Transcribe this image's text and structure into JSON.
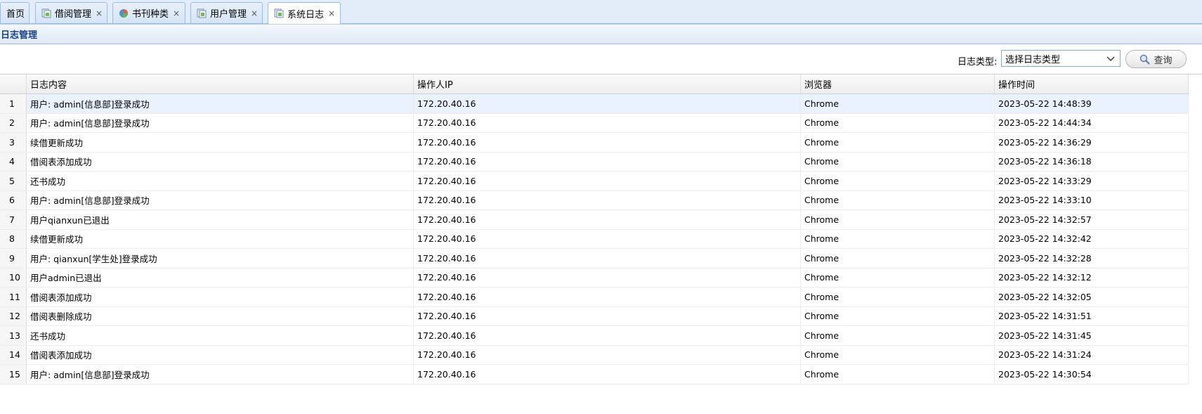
{
  "tabs": [
    {
      "label": "首页",
      "icon": "",
      "closable": false,
      "active": false
    },
    {
      "label": "借阅管理",
      "icon": "page-icon",
      "closable": true,
      "active": false
    },
    {
      "label": "书刊种类",
      "icon": "pie-chart-icon",
      "closable": true,
      "active": false
    },
    {
      "label": "用户管理",
      "icon": "page-icon",
      "closable": true,
      "active": false
    },
    {
      "label": "系统日志",
      "icon": "page-icon",
      "closable": true,
      "active": true
    }
  ],
  "tab_close_glyph": "×",
  "panel": {
    "title": "日志管理"
  },
  "toolbar": {
    "filter_label": "日志类型:",
    "filter_value": "选择日志类型",
    "query_label": "查询"
  },
  "grid": {
    "columns": [
      "",
      "日志内容",
      "操作人IP",
      "浏览器",
      "操作时间"
    ],
    "rows": [
      {
        "no": "1",
        "content": "用户: admin[信息部]登录成功",
        "ip": "172.20.40.16",
        "browser": "Chrome",
        "time": "2023-05-22 14:48:39"
      },
      {
        "no": "2",
        "content": "用户: admin[信息部]登录成功",
        "ip": "172.20.40.16",
        "browser": "Chrome",
        "time": "2023-05-22 14:44:34"
      },
      {
        "no": "3",
        "content": "续借更新成功",
        "ip": "172.20.40.16",
        "browser": "Chrome",
        "time": "2023-05-22 14:36:29"
      },
      {
        "no": "4",
        "content": "借阅表添加成功",
        "ip": "172.20.40.16",
        "browser": "Chrome",
        "time": "2023-05-22 14:36:18"
      },
      {
        "no": "5",
        "content": "还书成功",
        "ip": "172.20.40.16",
        "browser": "Chrome",
        "time": "2023-05-22 14:33:29"
      },
      {
        "no": "6",
        "content": "用户: admin[信息部]登录成功",
        "ip": "172.20.40.16",
        "browser": "Chrome",
        "time": "2023-05-22 14:33:10"
      },
      {
        "no": "7",
        "content": "用户qianxun已退出",
        "ip": "172.20.40.16",
        "browser": "Chrome",
        "time": "2023-05-22 14:32:57"
      },
      {
        "no": "8",
        "content": "续借更新成功",
        "ip": "172.20.40.16",
        "browser": "Chrome",
        "time": "2023-05-22 14:32:42"
      },
      {
        "no": "9",
        "content": "用户: qianxun[学生处]登录成功",
        "ip": "172.20.40.16",
        "browser": "Chrome",
        "time": "2023-05-22 14:32:28"
      },
      {
        "no": "10",
        "content": "用户admin已退出",
        "ip": "172.20.40.16",
        "browser": "Chrome",
        "time": "2023-05-22 14:32:12"
      },
      {
        "no": "11",
        "content": "借阅表添加成功",
        "ip": "172.20.40.16",
        "browser": "Chrome",
        "time": "2023-05-22 14:32:05"
      },
      {
        "no": "12",
        "content": "借阅表删除成功",
        "ip": "172.20.40.16",
        "browser": "Chrome",
        "time": "2023-05-22 14:31:51"
      },
      {
        "no": "13",
        "content": "还书成功",
        "ip": "172.20.40.16",
        "browser": "Chrome",
        "time": "2023-05-22 14:31:45"
      },
      {
        "no": "14",
        "content": "借阅表添加成功",
        "ip": "172.20.40.16",
        "browser": "Chrome",
        "time": "2023-05-22 14:31:24"
      },
      {
        "no": "15",
        "content": "用户: admin[信息部]登录成功",
        "ip": "172.20.40.16",
        "browser": "Chrome",
        "time": "2023-05-22 14:30:54"
      }
    ],
    "selected_row": 1
  },
  "colors": {
    "accent": "#99bbe8",
    "header_text": "#15428b",
    "selected_row": "#eaf2fe"
  }
}
